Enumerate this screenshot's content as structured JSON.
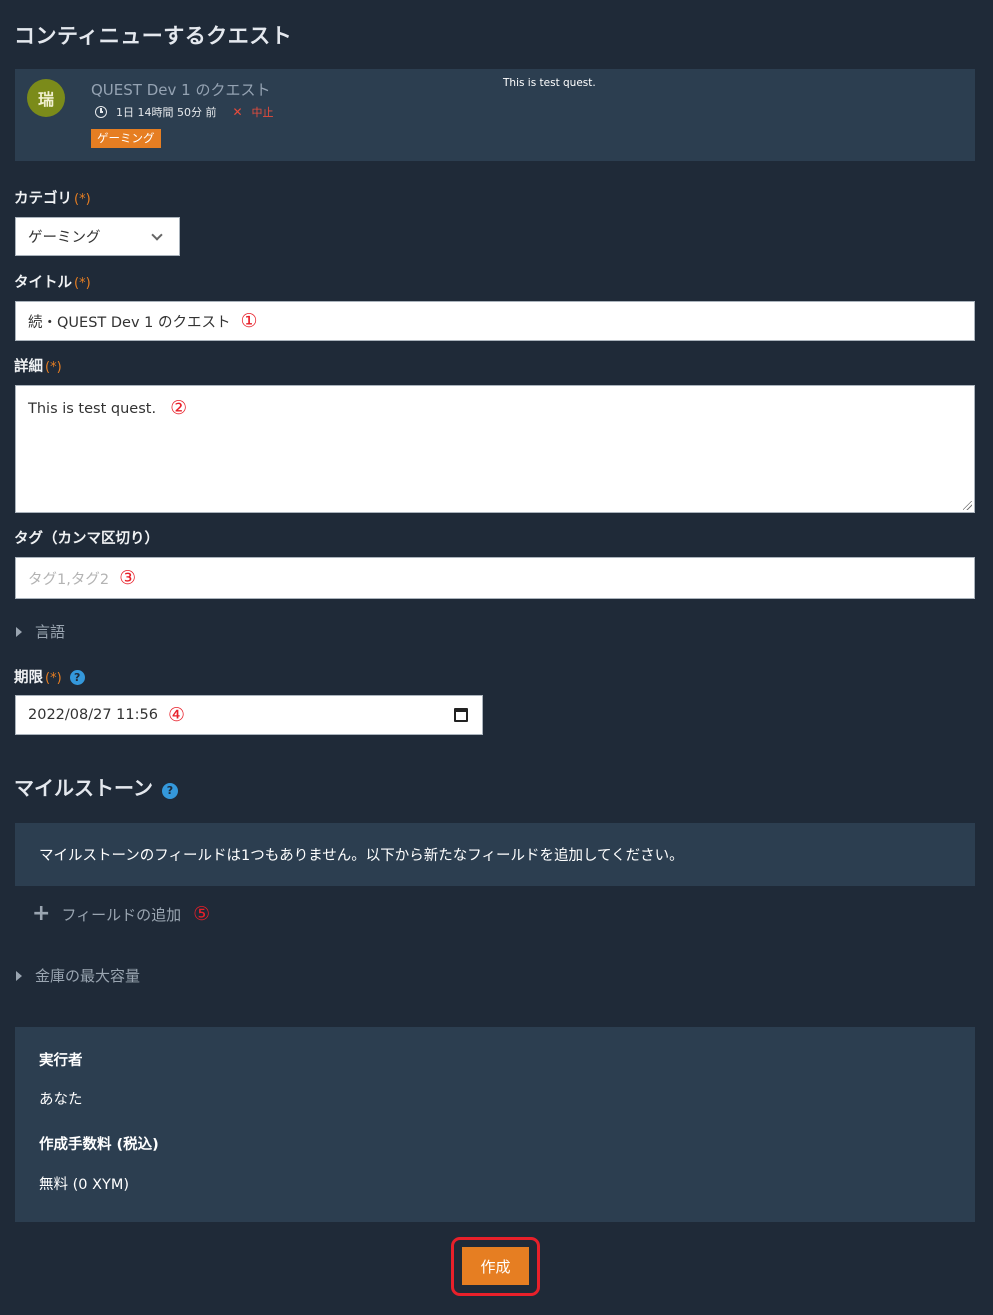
{
  "page_title": "コンティニューするクエスト",
  "quest": {
    "avatar_text": "瑞",
    "name": "QUEST Dev 1 のクエスト",
    "elapsed": "1日 14時間 50分 前",
    "status": "中止",
    "tag": "ゲーミング",
    "description": "This is test quest."
  },
  "form": {
    "required_mark": "(*)",
    "category": {
      "label": "カテゴリ",
      "value": "ゲーミング"
    },
    "title": {
      "label": "タイトル",
      "value": "続・QUEST Dev 1 のクエスト",
      "marker": "①"
    },
    "detail": {
      "label": "詳細",
      "value": "This is test quest.",
      "marker": "②"
    },
    "tags": {
      "label": "タグ（カンマ区切り）",
      "placeholder": "タグ1,タグ2",
      "marker": "③"
    },
    "language": {
      "label": "言語"
    },
    "deadline": {
      "label": "期限",
      "value": "2022/08/27 11:56",
      "marker": "④",
      "help": "?"
    }
  },
  "milestone": {
    "title": "マイルストーン",
    "help": "?",
    "empty_message": "マイルストーンのフィールドは1つもありません。以下から新たなフィールドを追加してください。",
    "add_label": "フィールドの追加",
    "add_marker": "⑤"
  },
  "vault": {
    "label": "金庫の最大容量"
  },
  "summary": {
    "executor_label": "実行者",
    "executor_value": "あなた",
    "fee_label": "作成手数料 (税込)",
    "fee_value": "無料 (0 XYM)"
  },
  "create_button": "作成",
  "colors": {
    "background": "#1f2a38",
    "panel": "#2c3e50",
    "accent": "#e67e22",
    "marker": "#e8202a",
    "help": "#3498db"
  }
}
